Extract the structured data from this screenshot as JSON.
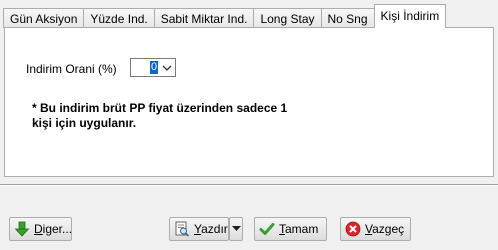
{
  "tabs": [
    {
      "label": "Gün Aksiyon"
    },
    {
      "label": "Yüzde Ind."
    },
    {
      "label": "Sabit Miktar Ind."
    },
    {
      "label": "Long Stay"
    },
    {
      "label": "No Sng"
    },
    {
      "label": "Kişi İndirim"
    }
  ],
  "form": {
    "discount_label": "Indirim Orani (%)",
    "discount_value": "0",
    "note_line1": "* Bu indirim brüt PP fiyat üzerinden sadece 1",
    "note_line2": "kişi için uygulanır."
  },
  "buttons": {
    "other_prefix": "D",
    "other_rest": "iger...",
    "print_prefix": "Y",
    "print_rest": "azdır",
    "ok_prefix": "T",
    "ok_rest": "amam",
    "cancel_prefix": "V",
    "cancel_rest": "azgeç"
  },
  "icons": {
    "other": "green-down-arrow-icon",
    "print": "print-preview-icon",
    "ok": "green-check-icon",
    "cancel": "red-x-icon"
  },
  "colors": {
    "selection": "#0a64d6",
    "ok_green": "#3aa02c",
    "cancel_red": "#d9262a"
  }
}
